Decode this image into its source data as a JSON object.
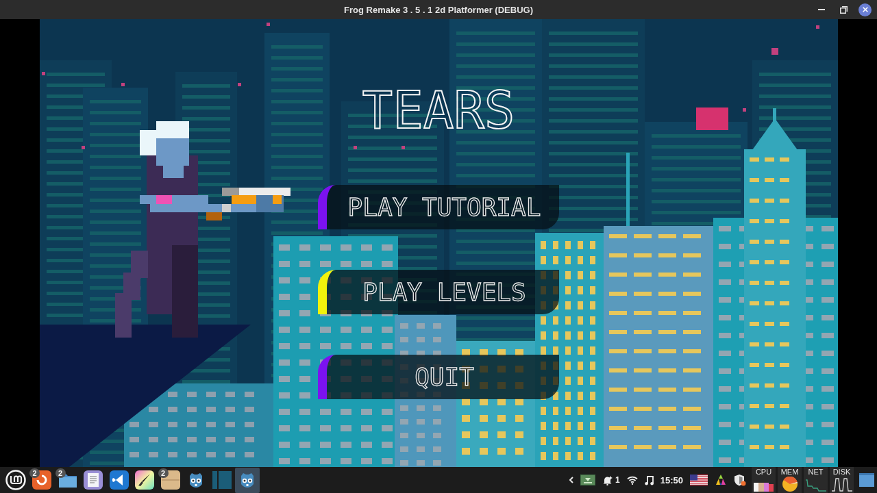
{
  "window": {
    "title": "Frog Remake 3 . 5 . 1 2d Platformer (DEBUG)"
  },
  "game": {
    "title": "TEARS",
    "menu": [
      {
        "label": "PLAY TUTORIAL",
        "color": "#7b12f0"
      },
      {
        "label": "PLAY LEVELS",
        "color": "#f2f20c"
      },
      {
        "label": "QUIT",
        "color": "#7b12f0"
      }
    ]
  },
  "taskbar": {
    "launchers": [
      {
        "kind": "ring",
        "badge": "2",
        "selected": false
      },
      {
        "kind": "folder",
        "badge": "2",
        "selected": false
      },
      {
        "kind": "document",
        "selected": false
      },
      {
        "kind": "code",
        "selected": false
      },
      {
        "kind": "brush",
        "selected": false
      },
      {
        "kind": "box",
        "badge": "2",
        "selected": false
      },
      {
        "kind": "robot",
        "selected": false
      },
      {
        "kind": "panels",
        "selected": false
      },
      {
        "kind": "robot",
        "selected": true
      }
    ],
    "tray": {
      "notification_count": "1",
      "clock": "15:50"
    },
    "monitors": [
      {
        "label": "CPU",
        "kind": "bars"
      },
      {
        "label": "MEM",
        "kind": "pie"
      },
      {
        "label": "NET",
        "kind": "line"
      },
      {
        "label": "DISK",
        "kind": "peaks"
      }
    ]
  }
}
